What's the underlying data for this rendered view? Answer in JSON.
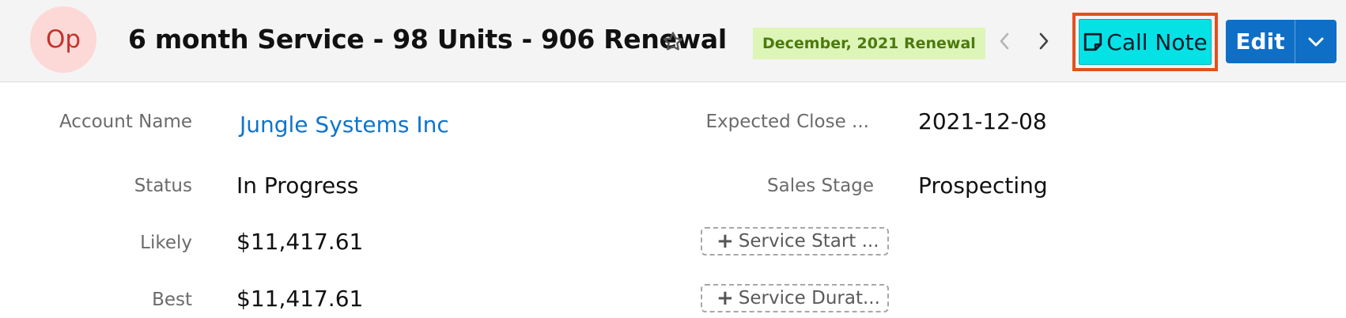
{
  "header": {
    "avatar_initials": "Op",
    "title": "6 month Service - 98 Units - 906 Renewal",
    "badge": "December, 2021 Renewal",
    "call_note_label": "Call Note",
    "edit_label": "Edit",
    "colors": {
      "avatar_bg": "#fcd9d6",
      "avatar_text": "#c1342c",
      "badge_bg": "#def5b8",
      "badge_text": "#4c7a0f",
      "call_note_bg": "#04e2e6",
      "highlight": "#e2501e",
      "edit_bg": "#0f6fc6"
    },
    "icons": [
      "star-icon",
      "chevron-left-icon",
      "chevron-right-icon",
      "note-icon",
      "chevron-down-icon"
    ]
  },
  "fields": {
    "account_name": {
      "label": "Account Name",
      "value": "Jungle Systems Inc"
    },
    "status": {
      "label": "Status",
      "value": "In Progress"
    },
    "likely": {
      "label": "Likely",
      "value": "$11,417.61"
    },
    "best": {
      "label": "Best",
      "value": "$11,417.61"
    },
    "expected_close": {
      "label": "Expected Close ...",
      "value": "2021-12-08"
    },
    "sales_stage": {
      "label": "Sales Stage",
      "value": "Prospecting"
    },
    "service_start": {
      "label": "Service Start ..."
    },
    "service_duration": {
      "label": "Service Durat..."
    }
  }
}
